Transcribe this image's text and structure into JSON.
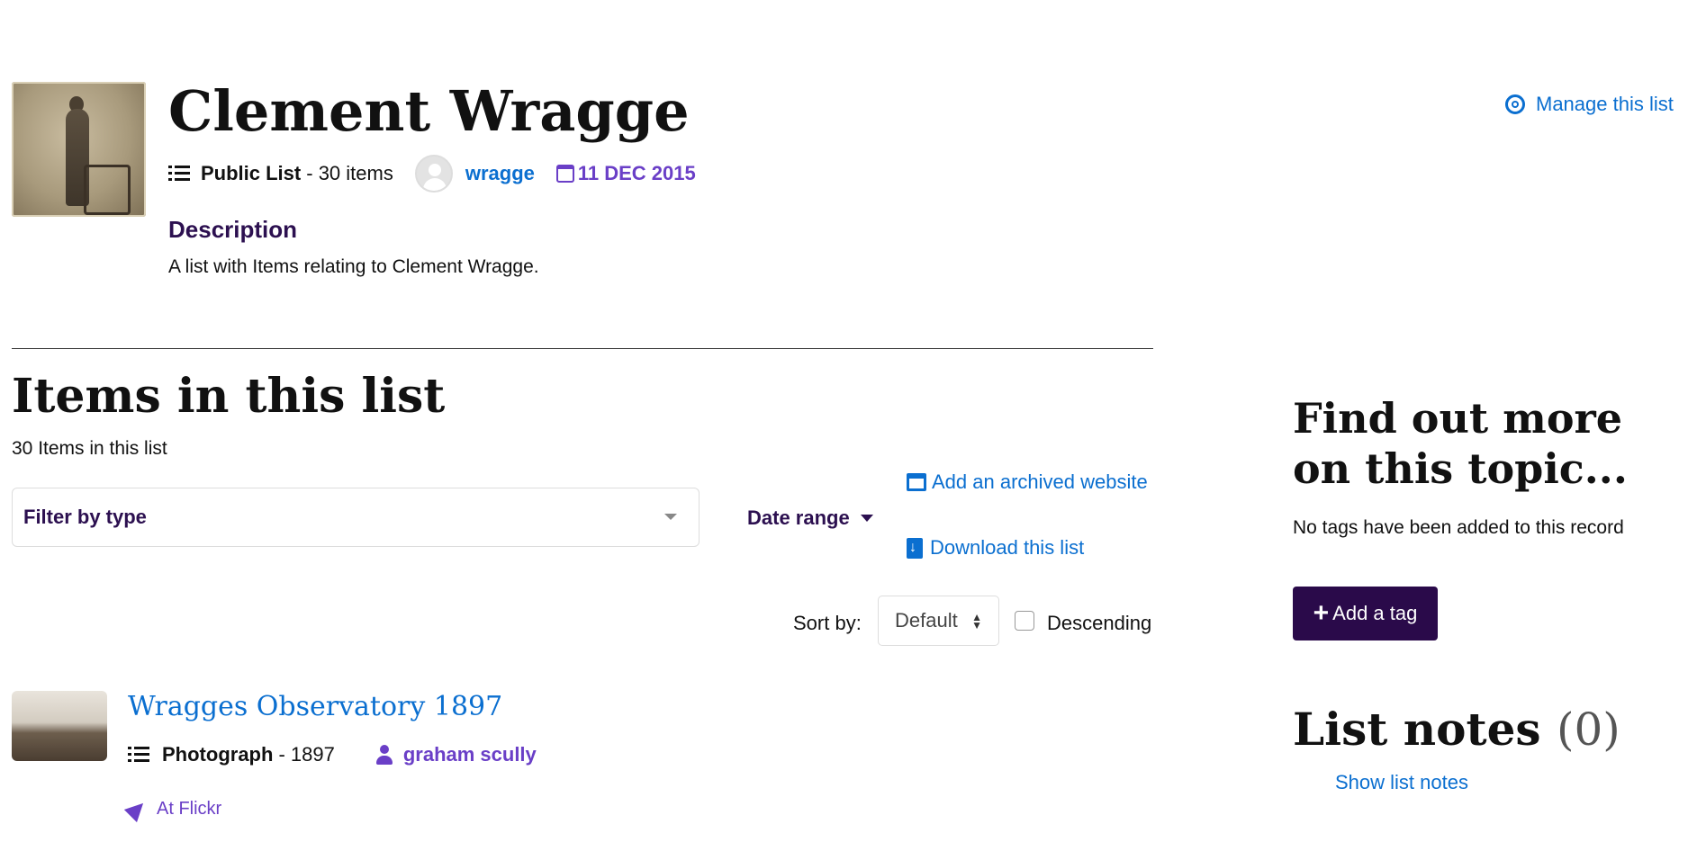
{
  "header": {
    "title": "Clement Wragge",
    "list_type": "Public List",
    "item_count": "- 30 items",
    "owner": "wragge",
    "date": "11 DEC 2015",
    "manage_label": "Manage this list"
  },
  "description": {
    "heading": "Description",
    "text": "A list with Items relating to Clement Wragge."
  },
  "items_section": {
    "heading": "Items in this list",
    "count_text": "30 Items in this list",
    "filter_label": "Filter by type",
    "date_range_label": "Date range",
    "archive_link": "Add an archived website",
    "download_link": "Download this list",
    "sort_label": "Sort by:",
    "sort_value": "Default",
    "descending_label": "Descending"
  },
  "items": [
    {
      "title": "Wragges Observatory 1897",
      "type": "Photograph",
      "year": "- 1897",
      "contributor": "graham scully",
      "source": "At Flickr"
    }
  ],
  "sidebar": {
    "find_heading": "Find out more on this topic...",
    "no_tags": "No tags have been added to this record",
    "add_tag": "Add a tag",
    "notes_heading": "List notes",
    "notes_count": "(0)",
    "show_notes": "Show list notes"
  },
  "colors": {
    "link": "#0b6fd0",
    "accent_purple": "#6a3fc7",
    "dark_purple": "#2a0a4a"
  }
}
